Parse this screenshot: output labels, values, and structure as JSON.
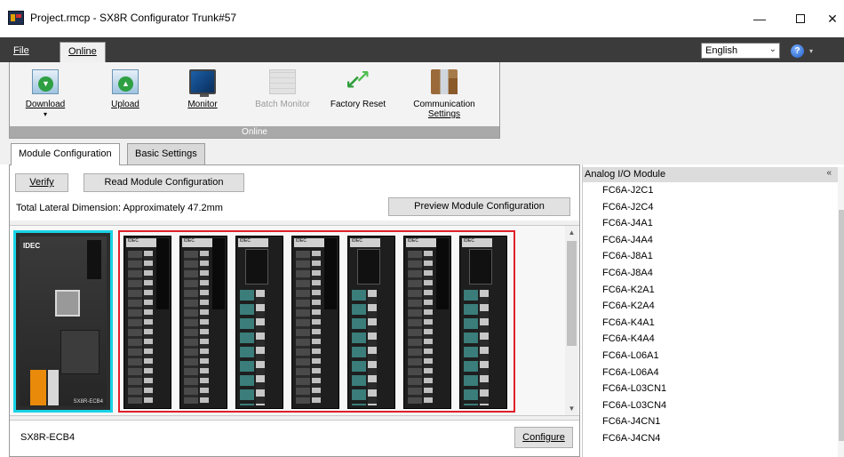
{
  "window": {
    "title": "Project.rmcp - SX8R Configurator Trunk#57",
    "minimize_glyph": "—",
    "close_glyph": "✕"
  },
  "menu": {
    "file": "File",
    "online": "Online",
    "language": "English",
    "help_glyph": "?"
  },
  "ribbon": {
    "group_label": "Online",
    "buttons": [
      {
        "label": "Download",
        "sub": "▾",
        "icon": "download-icon",
        "enabled": true
      },
      {
        "label": "Upload",
        "icon": "upload-icon",
        "enabled": true
      },
      {
        "label": "Monitor",
        "icon": "monitor-icon",
        "enabled": true
      },
      {
        "label": "Batch Monitor",
        "icon": "batch-monitor-icon",
        "enabled": false
      },
      {
        "label": "Factory Reset",
        "icon": "factory-reset-icon",
        "enabled": true
      },
      {
        "label": "Communication",
        "label2": "Settings",
        "icon": "communication-settings-icon",
        "enabled": true
      }
    ]
  },
  "tabs": [
    {
      "label": "Module Configuration",
      "active": true
    },
    {
      "label": "Basic Settings",
      "active": false
    }
  ],
  "module_config": {
    "verify_label": "Verify",
    "read_label": "Read Module Configuration",
    "dimension_text": "Total Lateral Dimension: Approximately 47.2mm",
    "preview_label": "Preview Module Configuration",
    "cpu_brand": "IDEC",
    "cpu_model_label": "SX8R-ECB4",
    "io_modules": [
      {
        "type": "digital",
        "brand": "IDEC"
      },
      {
        "type": "digital",
        "brand": "IDEC"
      },
      {
        "type": "analog",
        "brand": "IDEC"
      },
      {
        "type": "digital",
        "brand": "IDEC"
      },
      {
        "type": "analog",
        "brand": "IDEC"
      },
      {
        "type": "digital",
        "brand": "IDEC"
      },
      {
        "type": "analog",
        "brand": "IDEC"
      }
    ],
    "selected_module": "SX8R-ECB4",
    "configure_label": "Configure"
  },
  "module_catalog": {
    "category": "Analog I/O Module",
    "items": [
      "FC6A-J2C1",
      "FC6A-J2C4",
      "FC6A-J4A1",
      "FC6A-J4A4",
      "FC6A-J8A1",
      "FC6A-J8A4",
      "FC6A-K2A1",
      "FC6A-K2A4",
      "FC6A-K4A1",
      "FC6A-K4A4",
      "FC6A-L06A1",
      "FC6A-L06A4",
      "FC6A-L03CN1",
      "FC6A-L03CN4",
      "FC6A-J4CN1",
      "FC6A-J4CN4"
    ]
  },
  "colors": {
    "cpu_highlight": "#19d3e6",
    "io_highlight": "#e0202a",
    "menubar": "#3b3b3b"
  }
}
